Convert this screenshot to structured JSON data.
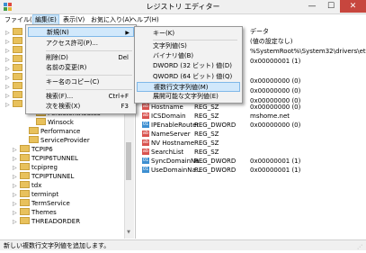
{
  "window": {
    "title": "レジストリ エディター",
    "minimize": "—",
    "maximize": "☐",
    "close": "✕"
  },
  "menubar": [
    "ファイル(F)",
    "編集(E)",
    "表示(V)",
    "お気に入り(A)",
    "ヘルプ(H)"
  ],
  "tree": [
    "PersistentRoutes",
    "Winsock",
    "Performance",
    "ServiceProvider",
    "TCPIP6",
    "TCPIP6TUNNEL",
    "tcpipreg",
    "TCPIPTUNNEL",
    "tdx",
    "terminpt",
    "TermService",
    "Themes",
    "THREADORDER"
  ],
  "list_header_partial": "データ",
  "list_top": [
    {
      "data": "(値の設定なし)"
    },
    {
      "data": "%SystemRoot%\\System32\\drivers\\etc"
    },
    {
      "data": "0x00000001 (1)"
    },
    {
      "data": ""
    },
    {
      "data": "0x00000000 (0)"
    },
    {
      "data": "0x00000000 (0)"
    },
    {
      "data": "0x00000000 (0)"
    },
    {
      "data": "0x00000000 (0)"
    }
  ],
  "list_rows": [
    {
      "name": "Hostname",
      "type": "REG_SZ",
      "data": ""
    },
    {
      "name": "ICSDomain",
      "type": "REG_SZ",
      "data": "mshome.net"
    },
    {
      "name": "IPEnableRouter",
      "type": "REG_DWORD",
      "data": "0x00000000 (0)"
    },
    {
      "name": "NameServer",
      "type": "REG_SZ",
      "data": ""
    },
    {
      "name": "NV Hostname",
      "type": "REG_SZ",
      "data": ""
    },
    {
      "name": "SearchList",
      "type": "REG_SZ",
      "data": ""
    },
    {
      "name": "SyncDomainNa...",
      "type": "REG_DWORD",
      "data": "0x00000001 (1)"
    },
    {
      "name": "UseDomainNa...",
      "type": "REG_DWORD",
      "data": "0x00000001 (1)"
    }
  ],
  "edit_menu": {
    "items": [
      {
        "label": "新規(N)",
        "shortcut": "",
        "submenu": true
      },
      {
        "label": "アクセス許可(P)...",
        "shortcut": ""
      },
      {
        "label": "削除(D)",
        "shortcut": "Del"
      },
      {
        "label": "名前の変更(R)",
        "shortcut": ""
      },
      {
        "label": "キー名のコピー(C)",
        "shortcut": ""
      },
      {
        "label": "検索(F)...",
        "shortcut": "Ctrl+F"
      },
      {
        "label": "次を検索(X)",
        "shortcut": "F3"
      }
    ]
  },
  "new_submenu": {
    "items": [
      "キー(K)",
      "文字列値(S)",
      "バイナリ値(B)",
      "DWORD (32 ビット) 値(D)",
      "QWORD (64 ビット) 値(Q)",
      "複数行文字列値(M)",
      "展開可能な文字列値(E)"
    ]
  },
  "status": "新しい複数行文字列値を追加します。"
}
